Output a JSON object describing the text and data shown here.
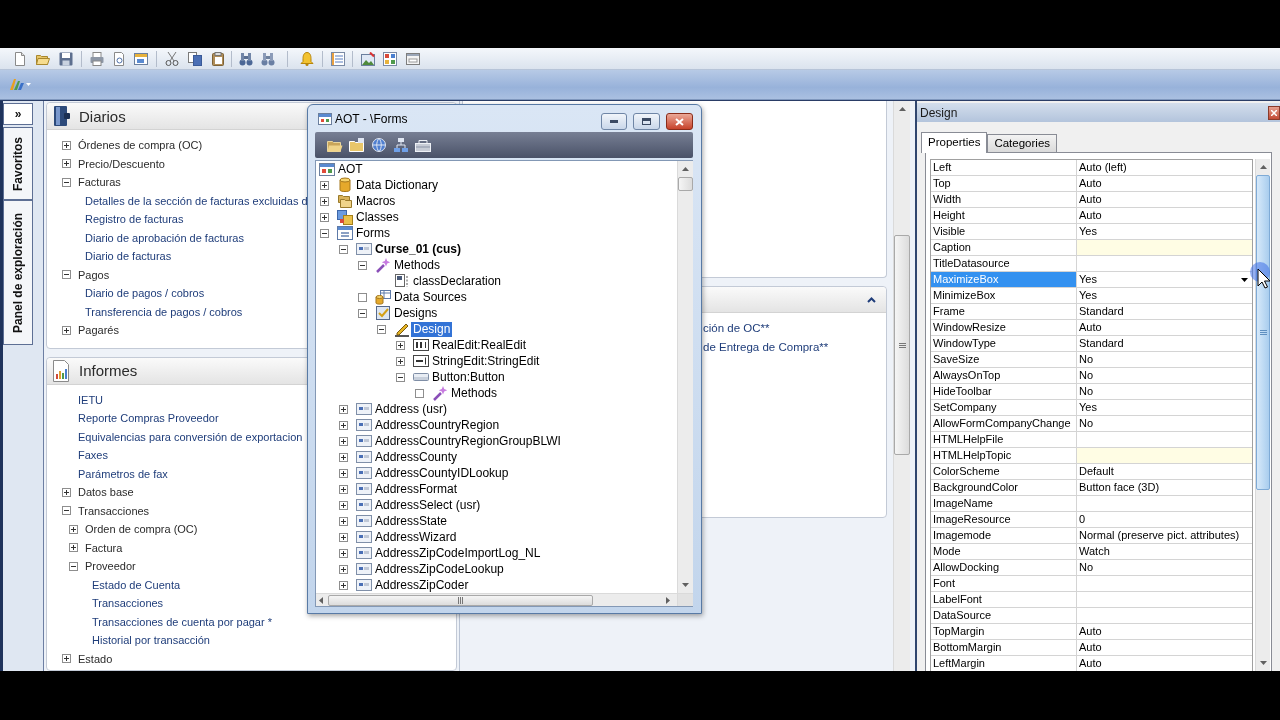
{
  "side_panel": {
    "toggle": "»",
    "tabs": [
      "Favoritos",
      "Panel de exploración"
    ]
  },
  "navigation": {
    "sections": [
      {
        "title": "Diarios",
        "kind": "journals",
        "items": [
          {
            "label": "Órdenes de compra (OC)",
            "expanded": false
          },
          {
            "label": "Precio/Descuento",
            "expanded": false
          },
          {
            "label": "Facturas",
            "expanded": true,
            "children": [
              {
                "label": "Detalles de la sección de facturas excluidas d"
              },
              {
                "label": "Registro de facturas"
              },
              {
                "label": "Diario de aprobación de facturas"
              },
              {
                "label": "Diario de facturas"
              }
            ]
          },
          {
            "label": "Pagos",
            "expanded": true,
            "children": [
              {
                "label": "Diario de pagos / cobros"
              },
              {
                "label": "Transferencia de pagos / cobros"
              }
            ]
          },
          {
            "label": "Pagarés",
            "expanded": false
          }
        ]
      },
      {
        "title": "Informes",
        "kind": "reports",
        "items": [
          {
            "label": "IETU"
          },
          {
            "label": "Reporte Compras Proveedor"
          },
          {
            "label": "Equivalencias para conversión de exportacion"
          },
          {
            "label": "Faxes"
          },
          {
            "label": "Parámetros de fax"
          },
          {
            "label": "Datos base",
            "expanded": false
          },
          {
            "label": "Transacciones",
            "expanded": true,
            "children": [
              {
                "label": "Orden de compra (OC)",
                "expanded": false
              },
              {
                "label": "Factura",
                "expanded": false
              },
              {
                "label": "Proveedor",
                "expanded": true,
                "children": [
                  {
                    "label": "Estado de Cuenta"
                  },
                  {
                    "label": "Transacciones"
                  },
                  {
                    "label": "Transacciones de cuenta por pagar *"
                  },
                  {
                    "label": "Historial por transacción"
                  }
                ]
              }
            ]
          },
          {
            "label": "Estado",
            "expanded": false
          }
        ]
      }
    ]
  },
  "aot_window": {
    "title": "AOT - \\Forms",
    "tree": [
      {
        "label": "AOT",
        "kind": "root",
        "selected": false,
        "bold": false,
        "children": [
          {
            "label": "Data Dictionary",
            "kind": "dictionary",
            "expanded": false,
            "selected": false,
            "bold": false
          },
          {
            "label": "Macros",
            "kind": "macros",
            "expanded": false,
            "selected": false,
            "bold": false
          },
          {
            "label": "Classes",
            "kind": "classes",
            "expanded": false,
            "selected": false,
            "bold": false
          },
          {
            "label": "Forms",
            "kind": "forms",
            "expanded": true,
            "selected": false,
            "bold": false,
            "children": [
              {
                "label": "Curse_01 (cus)",
                "kind": "form",
                "expanded": true,
                "selected": false,
                "bold": true,
                "children": [
                  {
                    "label": "Methods",
                    "kind": "methods",
                    "expanded": true,
                    "selected": false,
                    "bold": false,
                    "children": [
                      {
                        "label": "classDeclaration",
                        "kind": "method",
                        "selected": false,
                        "bold": false
                      }
                    ]
                  },
                  {
                    "label": "Data Sources",
                    "kind": "datasources",
                    "empty": true,
                    "selected": false,
                    "bold": false
                  },
                  {
                    "label": "Designs",
                    "kind": "designs",
                    "expanded": true,
                    "selected": false,
                    "bold": false,
                    "children": [
                      {
                        "label": "Design",
                        "kind": "design",
                        "expanded": true,
                        "selected": true,
                        "bold": false,
                        "children": [
                          {
                            "label": "RealEdit:RealEdit",
                            "kind": "realedit",
                            "expanded": false,
                            "selected": false,
                            "bold": false
                          },
                          {
                            "label": "StringEdit:StringEdit",
                            "kind": "stringedit",
                            "expanded": false,
                            "selected": false,
                            "bold": false
                          },
                          {
                            "label": "Button:Button",
                            "kind": "button",
                            "expanded": true,
                            "selected": false,
                            "bold": false,
                            "children": [
                              {
                                "label": "Methods",
                                "kind": "methods",
                                "empty": true,
                                "selected": false,
                                "bold": false
                              }
                            ]
                          }
                        ]
                      }
                    ]
                  }
                ]
              },
              {
                "label": "Address (usr)",
                "kind": "form",
                "expanded": false,
                "selected": false,
                "bold": false
              },
              {
                "label": "AddressCountryRegion",
                "kind": "form",
                "expanded": false,
                "selected": false,
                "bold": false
              },
              {
                "label": "AddressCountryRegionGroupBLWI",
                "kind": "form",
                "expanded": false,
                "selected": false,
                "bold": false
              },
              {
                "label": "AddressCounty",
                "kind": "form",
                "expanded": false,
                "selected": false,
                "bold": false
              },
              {
                "label": "AddressCountyIDLookup",
                "kind": "form",
                "expanded": false,
                "selected": false,
                "bold": false
              },
              {
                "label": "AddressFormat",
                "kind": "form",
                "expanded": false,
                "selected": false,
                "bold": false
              },
              {
                "label": "AddressSelect (usr)",
                "kind": "form",
                "expanded": false,
                "selected": false,
                "bold": false
              },
              {
                "label": "AddressState",
                "kind": "form",
                "expanded": false,
                "selected": false,
                "bold": false
              },
              {
                "label": "AddressWizard",
                "kind": "form",
                "expanded": false,
                "selected": false,
                "bold": false
              },
              {
                "label": "AddressZipCodeImportLog_NL",
                "kind": "form",
                "expanded": false,
                "selected": false,
                "bold": false
              },
              {
                "label": "AddressZipCodeLookup",
                "kind": "form",
                "expanded": false,
                "selected": false,
                "bold": false
              },
              {
                "label": "AddressZipCoder",
                "kind": "form",
                "expanded": false,
                "selected": false,
                "bold": false
              }
            ]
          }
        ]
      }
    ]
  },
  "middle_panel": {
    "links": [
      "ción de OC**",
      "de Entrega de Compra**"
    ]
  },
  "properties_window": {
    "title": "Design",
    "tabs": [
      {
        "label": "Properties",
        "selected": true
      },
      {
        "label": "Categories",
        "selected": false
      }
    ],
    "rows": [
      {
        "name": "Left",
        "value": "Auto (left)",
        "selected": false,
        "tinted": false
      },
      {
        "name": "Top",
        "value": "Auto",
        "selected": false,
        "tinted": false
      },
      {
        "name": "Width",
        "value": "Auto",
        "selected": false,
        "tinted": false
      },
      {
        "name": "Height",
        "value": "Auto",
        "selected": false,
        "tinted": false
      },
      {
        "name": "Visible",
        "value": "Yes",
        "selected": false,
        "tinted": false
      },
      {
        "name": "Caption",
        "selected": false,
        "tinted": true
      },
      {
        "name": "TitleDatasource",
        "selected": false,
        "tinted": false
      },
      {
        "name": "MaximizeBox",
        "value": "Yes",
        "selected": true,
        "tinted": false
      },
      {
        "name": "MinimizeBox",
        "value": "Yes",
        "selected": false,
        "tinted": false
      },
      {
        "name": "Frame",
        "value": "Standard",
        "selected": false,
        "tinted": false
      },
      {
        "name": "WindowResize",
        "value": "Auto",
        "selected": false,
        "tinted": false
      },
      {
        "name": "WindowType",
        "value": "Standard",
        "selected": false,
        "tinted": false
      },
      {
        "name": "SaveSize",
        "value": "No",
        "selected": false,
        "tinted": false
      },
      {
        "name": "AlwaysOnTop",
        "value": "No",
        "selected": false,
        "tinted": false
      },
      {
        "name": "HideToolbar",
        "value": "No",
        "selected": false,
        "tinted": false
      },
      {
        "name": "SetCompany",
        "value": "Yes",
        "selected": false,
        "tinted": false
      },
      {
        "name": "AllowFormCompanyChange",
        "value": "No",
        "selected": false,
        "tinted": false
      },
      {
        "name": "HTMLHelpFile",
        "selected": false,
        "tinted": false
      },
      {
        "name": "HTMLHelpTopic",
        "selected": false,
        "tinted": true
      },
      {
        "name": "ColorScheme",
        "value": "Default",
        "selected": false,
        "tinted": false
      },
      {
        "name": "BackgroundColor",
        "value": "Button face (3D)",
        "selected": false,
        "tinted": false
      },
      {
        "name": "ImageName",
        "selected": false,
        "tinted": false
      },
      {
        "name": "ImageResource",
        "value": "0",
        "selected": false,
        "tinted": false
      },
      {
        "name": "Imagemode",
        "value": "Normal (preserve pict. attributes)",
        "selected": false,
        "tinted": false
      },
      {
        "name": "Mode",
        "value": "Watch",
        "selected": false,
        "tinted": false
      },
      {
        "name": "AllowDocking",
        "value": "No",
        "selected": false,
        "tinted": false
      },
      {
        "name": "Font",
        "selected": false,
        "tinted": false
      },
      {
        "name": "LabelFont",
        "selected": false,
        "tinted": false
      },
      {
        "name": "DataSource",
        "selected": false,
        "tinted": false
      },
      {
        "name": "TopMargin",
        "value": "Auto",
        "selected": false,
        "tinted": false
      },
      {
        "name": "BottomMargin",
        "value": "Auto",
        "selected": false,
        "tinted": false
      },
      {
        "name": "LeftMargin",
        "value": "Auto",
        "selected": false,
        "tinted": false
      }
    ]
  }
}
